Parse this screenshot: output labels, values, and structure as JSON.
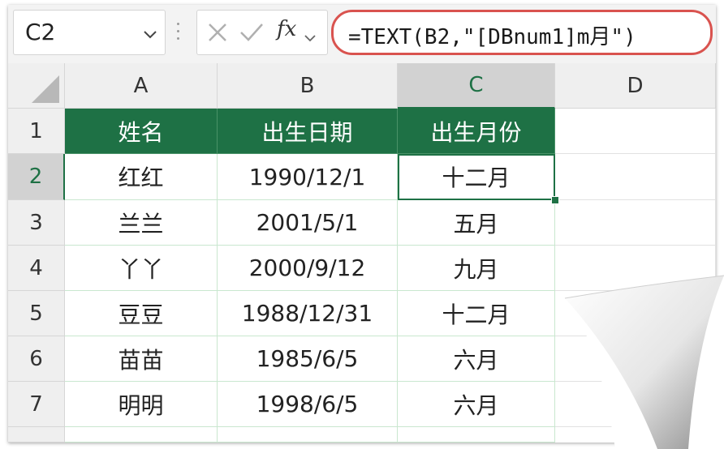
{
  "name_box": {
    "value": "C2"
  },
  "formula": {
    "text": "=TEXT(B2,\"[DBnum1]m月\")",
    "highlight_color": "#d9534f"
  },
  "icons": {
    "cancel": "cross-icon",
    "enter": "check-icon",
    "function": "fx-icon",
    "dropdown": "chevron-down-icon"
  },
  "columns": [
    "A",
    "B",
    "C",
    "D"
  ],
  "rows": [
    "1",
    "2",
    "3",
    "4",
    "5",
    "6",
    "7"
  ],
  "table": {
    "headers": [
      "姓名",
      "出生日期",
      "出生月份"
    ],
    "rows": [
      [
        "红红",
        "1990/12/1",
        "十二月"
      ],
      [
        "兰兰",
        "2001/5/1",
        "五月"
      ],
      [
        "丫丫",
        "2000/9/12",
        "九月"
      ],
      [
        "豆豆",
        "1988/12/31",
        "十二月"
      ],
      [
        "苗苗",
        "1985/6/5",
        "六月"
      ],
      [
        "明明",
        "1998/6/5",
        "六月"
      ]
    ],
    "header_color": "#1e7145"
  },
  "selection": {
    "cell": "C2"
  }
}
